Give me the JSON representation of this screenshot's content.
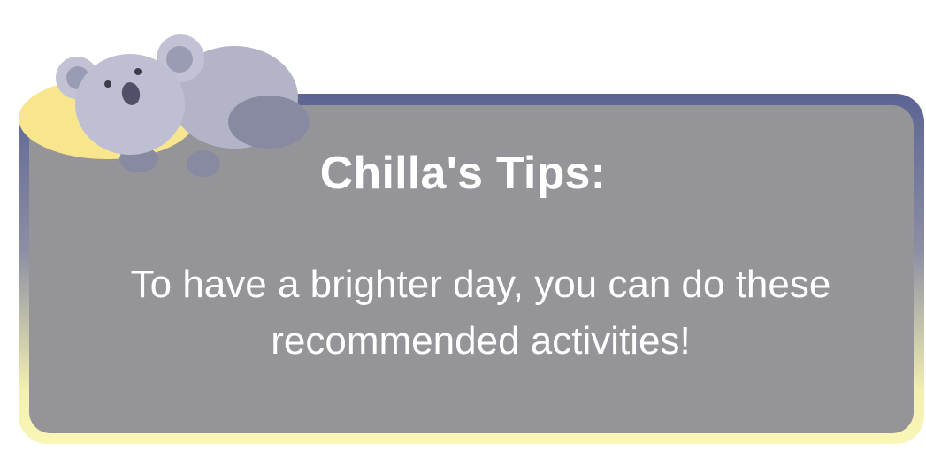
{
  "tip_card": {
    "title": "Chilla's Tips:",
    "message": "To have a brighter day, you can do these recommended activities!",
    "mascot_icon": "koala-icon"
  },
  "colors": {
    "frame_top": "#5c6494",
    "frame_bottom": "#faf6b8",
    "card_fill": "#949499",
    "moon": "#f7e68e",
    "koala_body": "#b4b4c8",
    "text": "#ffffff"
  }
}
